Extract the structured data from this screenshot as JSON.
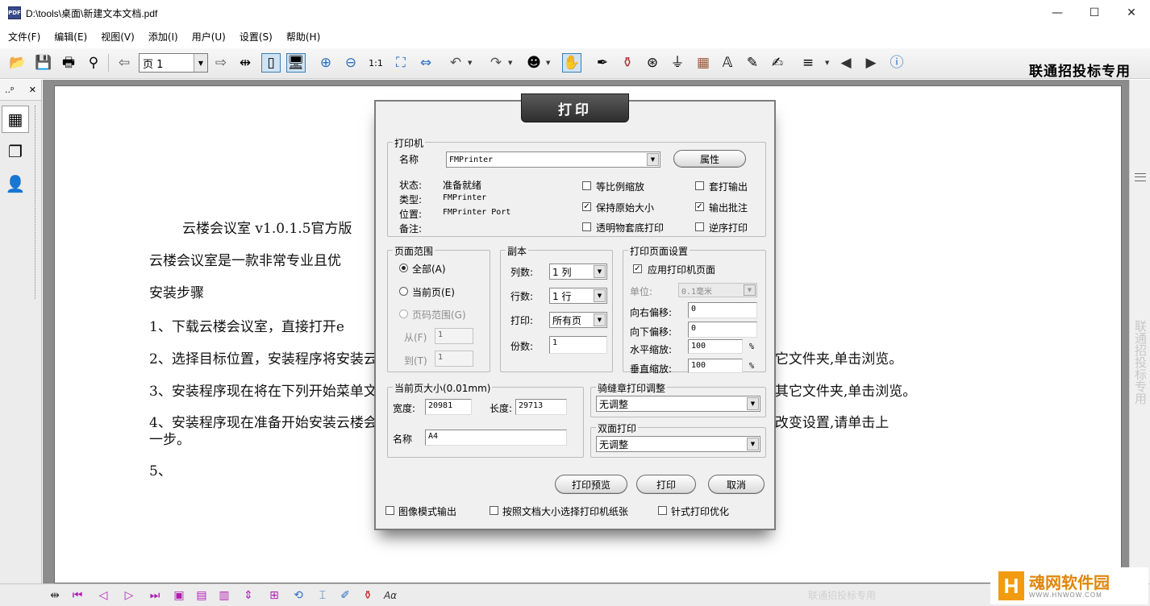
{
  "window": {
    "title": "D:\\tools\\桌面\\新建文本文档.pdf",
    "app_icon_text": "PDF",
    "minimize": "—",
    "maximize": "☐",
    "close": "✕"
  },
  "menu": [
    "文件(F)",
    "编辑(E)",
    "视图(V)",
    "添加(I)",
    "用户(U)",
    "设置(S)",
    "帮助(H)"
  ],
  "toolbar": {
    "page_value": "页 1",
    "brand": "联通招投标专用"
  },
  "left_panel": {
    "header": "..ᵖ",
    "close": "✕"
  },
  "document": {
    "lines": [
      "云楼会议室 v1.0.1.5官方版",
      "云楼会议室是一款非常专业且优",
      "安装步骤",
      "1、下载云楼会议室，直接打开e",
      "2、选择目标位置，安装程序将安装云楼会议室到下列文件夹中。要继续，单击下一步。如果您想选择其它文件夹,单击浏览。",
      "3、安装程序现在将在下列开始菜单文件夹中创建程序的快捷方式。要继续，单击下一步。如果您想选择其它文件夹,单击浏览。",
      "4、安装程序现在准备开始安装云楼会议室到您的电脑中。单击安装继续此安装程序。如果您想要回顾或改变设置,请单击上",
      "一步。",
      "5、"
    ]
  },
  "scrollbar": {
    "watermark": "联通招投标专用"
  },
  "bottombar": {
    "watermark": "联通招投标专用"
  },
  "site_logo": {
    "letter": "H",
    "name": "魂网软件园",
    "url": "WWW.HNWOW.COM"
  },
  "dialog": {
    "title": "打印",
    "printer": {
      "group_label": "打印机",
      "name_label": "名称",
      "name_value": "FMPrinter",
      "properties_button": "属性",
      "status_label": "状态:",
      "status_value": "准备就绪",
      "type_label": "类型:",
      "type_value": "FMPrinter",
      "location_label": "位置:",
      "location_value": "FMPrinter Port",
      "comment_label": "备注:",
      "options": [
        {
          "label": "等比例缩放",
          "checked": false
        },
        {
          "label": "保持原始大小",
          "checked": true
        },
        {
          "label": "透明物套底打印",
          "checked": false
        }
      ],
      "options_right": [
        {
          "label": "套打输出",
          "checked": false
        },
        {
          "label": "输出批注",
          "checked": true
        },
        {
          "label": "逆序打印",
          "checked": false
        }
      ]
    },
    "page_range": {
      "group_label": "页面范围",
      "all": "全部(A)",
      "current": "当前页(E)",
      "range": "页码范围(G)",
      "from_label": "从(F)",
      "from_value": "1",
      "to_label": "到(T)",
      "to_value": "1"
    },
    "copies": {
      "group_label": "副本",
      "cols_label": "列数:",
      "cols_value": "1 列",
      "rows_label": "行数:",
      "rows_value": "1 行",
      "print_label": "打印:",
      "print_value": "所有页",
      "count_label": "份数:",
      "count_value": "1"
    },
    "page_setup": {
      "group_label": "打印页面设置",
      "apply_label": "应用打印机页面",
      "apply_checked": true,
      "unit_label": "单位:",
      "unit_value": "0.1毫米",
      "right_offset_label": "向右偏移:",
      "right_offset_value": "0",
      "down_offset_label": "向下偏移:",
      "down_offset_value": "0",
      "h_scale_label": "水平缩放:",
      "h_scale_value": "100",
      "v_scale_label": "垂直缩放:",
      "v_scale_value": "100",
      "percent": "%"
    },
    "page_size": {
      "group_label": "当前页大小(0.01mm)",
      "width_label": "宽度:",
      "width_value": "20981",
      "height_label": "长度:",
      "height_value": "29713",
      "name_label": "名称",
      "name_value": "A4"
    },
    "saddle": {
      "group_label": "骑缝章打印调整",
      "value": "无调整"
    },
    "duplex": {
      "group_label": "双面打印",
      "value": "无调整"
    },
    "buttons": {
      "preview": "打印预览",
      "print": "打印",
      "cancel": "取消"
    },
    "bottom_options": [
      {
        "label": "图像模式输出",
        "checked": false
      },
      {
        "label": "按照文档大小选择打印机纸张",
        "checked": false
      },
      {
        "label": "针式打印优化",
        "checked": false
      }
    ]
  },
  "colors": {
    "accent": "#3c7fb1",
    "nav_icons": "#b01eb0",
    "dialog_title_bg": "#3a3a3a",
    "logo_orange": "#f29b11"
  }
}
